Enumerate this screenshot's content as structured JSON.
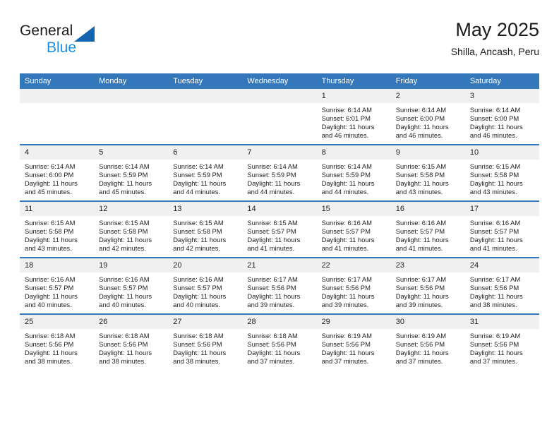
{
  "brand": {
    "name_top": "General",
    "name_bottom": "Blue",
    "triangle_color": "#1263b0",
    "blue_color": "#1f8fe0"
  },
  "header": {
    "title": "May 2025",
    "subtitle": "Shilla, Ancash, Peru"
  },
  "theme": {
    "header_bg": "#3477bb",
    "daynum_bg": "#f0f0f0",
    "text": "#222222"
  },
  "weekday_headers": [
    "Sunday",
    "Monday",
    "Tuesday",
    "Wednesday",
    "Thursday",
    "Friday",
    "Saturday"
  ],
  "labels": {
    "sunrise": "Sunrise:",
    "sunset": "Sunset:",
    "daylight": "Daylight:"
  },
  "weeks": [
    [
      {
        "day": "",
        "blank": true
      },
      {
        "day": "",
        "blank": true
      },
      {
        "day": "",
        "blank": true
      },
      {
        "day": "",
        "blank": true
      },
      {
        "day": "1",
        "sunrise": "Sunrise: 6:14 AM",
        "sunset": "Sunset: 6:01 PM",
        "daylight1": "Daylight: 11 hours",
        "daylight2": "and 46 minutes."
      },
      {
        "day": "2",
        "sunrise": "Sunrise: 6:14 AM",
        "sunset": "Sunset: 6:00 PM",
        "daylight1": "Daylight: 11 hours",
        "daylight2": "and 46 minutes."
      },
      {
        "day": "3",
        "sunrise": "Sunrise: 6:14 AM",
        "sunset": "Sunset: 6:00 PM",
        "daylight1": "Daylight: 11 hours",
        "daylight2": "and 46 minutes."
      }
    ],
    [
      {
        "day": "4",
        "sunrise": "Sunrise: 6:14 AM",
        "sunset": "Sunset: 6:00 PM",
        "daylight1": "Daylight: 11 hours",
        "daylight2": "and 45 minutes."
      },
      {
        "day": "5",
        "sunrise": "Sunrise: 6:14 AM",
        "sunset": "Sunset: 5:59 PM",
        "daylight1": "Daylight: 11 hours",
        "daylight2": "and 45 minutes."
      },
      {
        "day": "6",
        "sunrise": "Sunrise: 6:14 AM",
        "sunset": "Sunset: 5:59 PM",
        "daylight1": "Daylight: 11 hours",
        "daylight2": "and 44 minutes."
      },
      {
        "day": "7",
        "sunrise": "Sunrise: 6:14 AM",
        "sunset": "Sunset: 5:59 PM",
        "daylight1": "Daylight: 11 hours",
        "daylight2": "and 44 minutes."
      },
      {
        "day": "8",
        "sunrise": "Sunrise: 6:14 AM",
        "sunset": "Sunset: 5:59 PM",
        "daylight1": "Daylight: 11 hours",
        "daylight2": "and 44 minutes."
      },
      {
        "day": "9",
        "sunrise": "Sunrise: 6:15 AM",
        "sunset": "Sunset: 5:58 PM",
        "daylight1": "Daylight: 11 hours",
        "daylight2": "and 43 minutes."
      },
      {
        "day": "10",
        "sunrise": "Sunrise: 6:15 AM",
        "sunset": "Sunset: 5:58 PM",
        "daylight1": "Daylight: 11 hours",
        "daylight2": "and 43 minutes."
      }
    ],
    [
      {
        "day": "11",
        "sunrise": "Sunrise: 6:15 AM",
        "sunset": "Sunset: 5:58 PM",
        "daylight1": "Daylight: 11 hours",
        "daylight2": "and 43 minutes."
      },
      {
        "day": "12",
        "sunrise": "Sunrise: 6:15 AM",
        "sunset": "Sunset: 5:58 PM",
        "daylight1": "Daylight: 11 hours",
        "daylight2": "and 42 minutes."
      },
      {
        "day": "13",
        "sunrise": "Sunrise: 6:15 AM",
        "sunset": "Sunset: 5:58 PM",
        "daylight1": "Daylight: 11 hours",
        "daylight2": "and 42 minutes."
      },
      {
        "day": "14",
        "sunrise": "Sunrise: 6:15 AM",
        "sunset": "Sunset: 5:57 PM",
        "daylight1": "Daylight: 11 hours",
        "daylight2": "and 41 minutes."
      },
      {
        "day": "15",
        "sunrise": "Sunrise: 6:16 AM",
        "sunset": "Sunset: 5:57 PM",
        "daylight1": "Daylight: 11 hours",
        "daylight2": "and 41 minutes."
      },
      {
        "day": "16",
        "sunrise": "Sunrise: 6:16 AM",
        "sunset": "Sunset: 5:57 PM",
        "daylight1": "Daylight: 11 hours",
        "daylight2": "and 41 minutes."
      },
      {
        "day": "17",
        "sunrise": "Sunrise: 6:16 AM",
        "sunset": "Sunset: 5:57 PM",
        "daylight1": "Daylight: 11 hours",
        "daylight2": "and 41 minutes."
      }
    ],
    [
      {
        "day": "18",
        "sunrise": "Sunrise: 6:16 AM",
        "sunset": "Sunset: 5:57 PM",
        "daylight1": "Daylight: 11 hours",
        "daylight2": "and 40 minutes."
      },
      {
        "day": "19",
        "sunrise": "Sunrise: 6:16 AM",
        "sunset": "Sunset: 5:57 PM",
        "daylight1": "Daylight: 11 hours",
        "daylight2": "and 40 minutes."
      },
      {
        "day": "20",
        "sunrise": "Sunrise: 6:16 AM",
        "sunset": "Sunset: 5:57 PM",
        "daylight1": "Daylight: 11 hours",
        "daylight2": "and 40 minutes."
      },
      {
        "day": "21",
        "sunrise": "Sunrise: 6:17 AM",
        "sunset": "Sunset: 5:56 PM",
        "daylight1": "Daylight: 11 hours",
        "daylight2": "and 39 minutes."
      },
      {
        "day": "22",
        "sunrise": "Sunrise: 6:17 AM",
        "sunset": "Sunset: 5:56 PM",
        "daylight1": "Daylight: 11 hours",
        "daylight2": "and 39 minutes."
      },
      {
        "day": "23",
        "sunrise": "Sunrise: 6:17 AM",
        "sunset": "Sunset: 5:56 PM",
        "daylight1": "Daylight: 11 hours",
        "daylight2": "and 39 minutes."
      },
      {
        "day": "24",
        "sunrise": "Sunrise: 6:17 AM",
        "sunset": "Sunset: 5:56 PM",
        "daylight1": "Daylight: 11 hours",
        "daylight2": "and 38 minutes."
      }
    ],
    [
      {
        "day": "25",
        "sunrise": "Sunrise: 6:18 AM",
        "sunset": "Sunset: 5:56 PM",
        "daylight1": "Daylight: 11 hours",
        "daylight2": "and 38 minutes."
      },
      {
        "day": "26",
        "sunrise": "Sunrise: 6:18 AM",
        "sunset": "Sunset: 5:56 PM",
        "daylight1": "Daylight: 11 hours",
        "daylight2": "and 38 minutes."
      },
      {
        "day": "27",
        "sunrise": "Sunrise: 6:18 AM",
        "sunset": "Sunset: 5:56 PM",
        "daylight1": "Daylight: 11 hours",
        "daylight2": "and 38 minutes."
      },
      {
        "day": "28",
        "sunrise": "Sunrise: 6:18 AM",
        "sunset": "Sunset: 5:56 PM",
        "daylight1": "Daylight: 11 hours",
        "daylight2": "and 37 minutes."
      },
      {
        "day": "29",
        "sunrise": "Sunrise: 6:19 AM",
        "sunset": "Sunset: 5:56 PM",
        "daylight1": "Daylight: 11 hours",
        "daylight2": "and 37 minutes."
      },
      {
        "day": "30",
        "sunrise": "Sunrise: 6:19 AM",
        "sunset": "Sunset: 5:56 PM",
        "daylight1": "Daylight: 11 hours",
        "daylight2": "and 37 minutes."
      },
      {
        "day": "31",
        "sunrise": "Sunrise: 6:19 AM",
        "sunset": "Sunset: 5:56 PM",
        "daylight1": "Daylight: 11 hours",
        "daylight2": "and 37 minutes."
      }
    ]
  ]
}
